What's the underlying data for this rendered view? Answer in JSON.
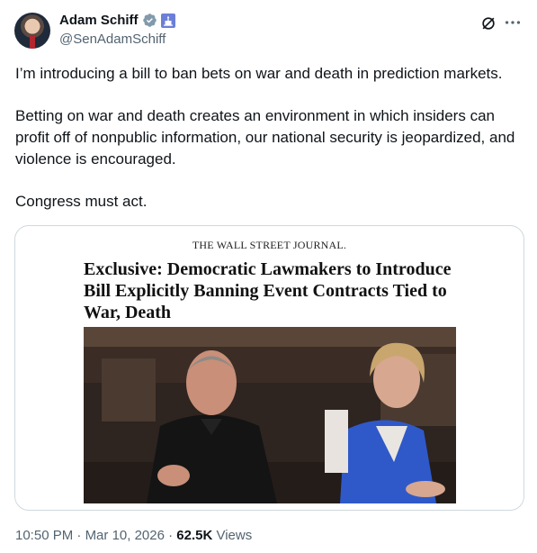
{
  "author": {
    "name": "Adam Schiff",
    "handle": "@SenAdamSchiff",
    "verified_color": "#829aab",
    "gov_badge_color": "#6c7fd8"
  },
  "tweet": {
    "paragraphs": [
      "I’m introducing a bill to ban bets on war and death in prediction markets.",
      "Betting on war and death creates an environment in which insiders can profit off of nonpublic information, our national security is jeopardized, and violence is encouraged.",
      "Congress must act."
    ]
  },
  "card": {
    "publication": "THE WALL STREET JOURNAL.",
    "headline": "Exclusive: Democratic Lawmakers to Introduce Bill Explicitly Banning Event Contracts Tied to War, Death"
  },
  "meta": {
    "time": "10:50 PM",
    "separator1": " · ",
    "date": "Mar 10, 2026",
    "separator2": " · ",
    "views_count": "62.5K",
    "views_label": " Views"
  },
  "icons": {
    "grok": "grok-icon",
    "more": "more-icon"
  }
}
